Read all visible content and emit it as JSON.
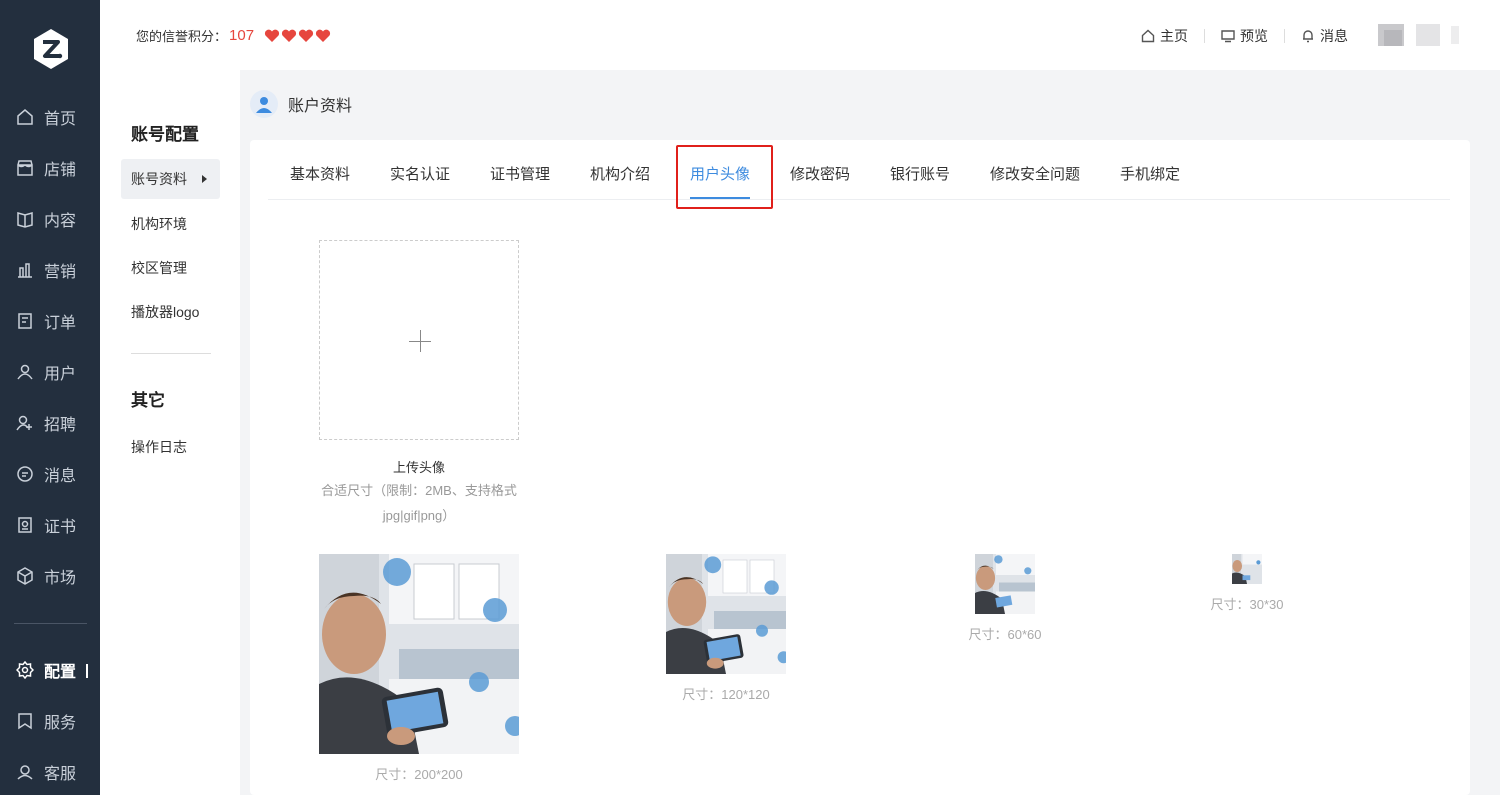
{
  "rail": {
    "items": [
      {
        "label": "首页",
        "icon": "home-icon"
      },
      {
        "label": "店铺",
        "icon": "store-icon"
      },
      {
        "label": "内容",
        "icon": "book-icon"
      },
      {
        "label": "营销",
        "icon": "chart-icon"
      },
      {
        "label": "订单",
        "icon": "order-icon"
      },
      {
        "label": "用户",
        "icon": "user-icon"
      },
      {
        "label": "招聘",
        "icon": "recruit-icon"
      },
      {
        "label": "消息",
        "icon": "chat-icon"
      },
      {
        "label": "证书",
        "icon": "certificate-icon"
      },
      {
        "label": "市场",
        "icon": "cube-icon"
      },
      {
        "label": "配置",
        "icon": "gear-icon"
      },
      {
        "label": "服务",
        "icon": "bookmark-icon"
      },
      {
        "label": "客服",
        "icon": "headset-icon"
      }
    ]
  },
  "header": {
    "credit_label": "您的信誉积分：",
    "credit_score": "107",
    "hearts": 4,
    "links": [
      {
        "label": "主页",
        "icon": "home-icon"
      },
      {
        "label": "预览",
        "icon": "monitor-icon"
      },
      {
        "label": "消息",
        "icon": "bell-icon"
      }
    ]
  },
  "subnav": {
    "group1": "账号配置",
    "group1_items": [
      "账号资料",
      "机构环境",
      "校区管理",
      "播放器logo"
    ],
    "group2": "其它",
    "group2_items": [
      "操作日志"
    ]
  },
  "page": {
    "title": "账户资料"
  },
  "tabs": [
    "基本资料",
    "实名认证",
    "证书管理",
    "机构介绍",
    "用户头像",
    "修改密码",
    "银行账号",
    "修改安全问题",
    "手机绑定"
  ],
  "upload": {
    "label": "上传头像",
    "hint": "合适尺寸（限制：2MB、支持格式jpg|gif|png）"
  },
  "previews": [
    {
      "label": "尺寸：200*200"
    },
    {
      "label": "尺寸：120*120"
    },
    {
      "label": "尺寸：60*60"
    },
    {
      "label": "尺寸：30*30"
    }
  ],
  "colors": {
    "rail_bg": "#232f3e",
    "accent": "#3d8bdf",
    "score_red": "#e6463e",
    "highlight_red": "#e0201b"
  }
}
